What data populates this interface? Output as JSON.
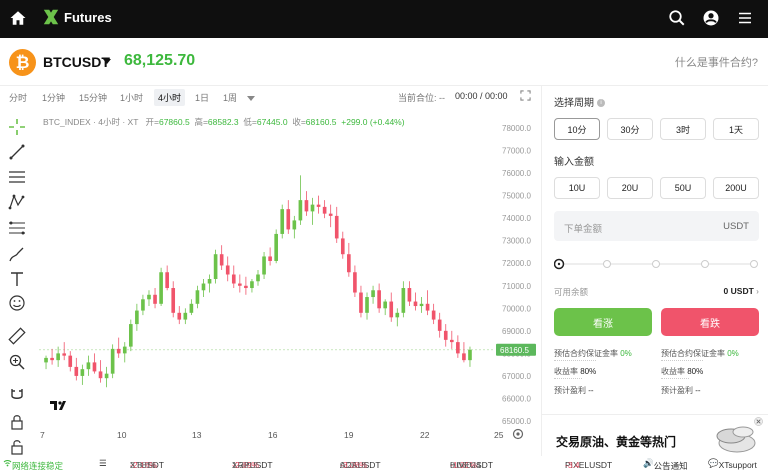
{
  "header": {
    "brand": "Futures",
    "icons": [
      "home-icon",
      "search-icon",
      "user-icon",
      "menu-icon"
    ]
  },
  "ticker": {
    "symbol": "BTCUSDT",
    "price": "68,125.70",
    "event_link": "什么是事件合约?",
    "coin_letter": "₿"
  },
  "chart_toolbar": {
    "timeframes": [
      "分时",
      "1分钟",
      "15分钟",
      "1小时",
      "4小时",
      "1日",
      "1周"
    ],
    "active_timeframe": "4小时",
    "position_info": "当前合位: --",
    "time_info": "00:00 / 00:00"
  },
  "chart_info": {
    "index_label": "BTC_INDEX · 4小时 · XT",
    "open_label": "开=",
    "open": "67860.5",
    "high_label": "高=",
    "high": "68582.3",
    "low_label": "低=",
    "low": "67445.0",
    "close_label": "收=",
    "close": "68160.5",
    "change": "+299.0 (+0.44%)"
  },
  "chart_data": {
    "type": "candlestick",
    "x_ticks": [
      "7",
      "10",
      "13",
      "16",
      "19",
      "22",
      "25"
    ],
    "y_ticks": [
      "78000.0",
      "77000.0",
      "76000.0",
      "75000.0",
      "74000.0",
      "73000.0",
      "72000.0",
      "71000.0",
      "70000.0",
      "69000.0",
      "68000.0",
      "67000.0",
      "66000.0",
      "65000.0"
    ],
    "ylim": [
      65000,
      78000
    ],
    "last_price_label": "68160.5",
    "last_price": 68160.5,
    "candles": [
      [
        67600,
        67900,
        67300,
        67800
      ],
      [
        67800,
        68200,
        67500,
        67700
      ],
      [
        67700,
        68300,
        67400,
        68000
      ],
      [
        68000,
        68500,
        67700,
        67900
      ],
      [
        67900,
        68100,
        67200,
        67400
      ],
      [
        67400,
        67800,
        66800,
        67000
      ],
      [
        67000,
        67500,
        66600,
        67300
      ],
      [
        67300,
        67900,
        67000,
        67600
      ],
      [
        67600,
        68000,
        67100,
        67200
      ],
      [
        67200,
        67700,
        66700,
        66900
      ],
      [
        66900,
        67400,
        66500,
        67100
      ],
      [
        67100,
        68400,
        66900,
        68200
      ],
      [
        68200,
        68700,
        67800,
        68000
      ],
      [
        68000,
        68500,
        67600,
        68300
      ],
      [
        68300,
        69500,
        68100,
        69300
      ],
      [
        69300,
        70200,
        69000,
        69900
      ],
      [
        69900,
        70600,
        69700,
        70400
      ],
      [
        70400,
        70800,
        70100,
        70600
      ],
      [
        70600,
        70900,
        70000,
        70200
      ],
      [
        70200,
        71800,
        70100,
        71600
      ],
      [
        71600,
        71900,
        70800,
        70900
      ],
      [
        70900,
        71200,
        69600,
        69800
      ],
      [
        69800,
        70100,
        69300,
        69500
      ],
      [
        69500,
        70000,
        69300,
        69800
      ],
      [
        69800,
        70400,
        69700,
        70200
      ],
      [
        70200,
        71000,
        70000,
        70800
      ],
      [
        70800,
        71300,
        70500,
        71100
      ],
      [
        71100,
        71500,
        70700,
        71300
      ],
      [
        71300,
        72600,
        71100,
        72400
      ],
      [
        72400,
        72800,
        71700,
        71900
      ],
      [
        71900,
        72300,
        71200,
        71500
      ],
      [
        71500,
        71900,
        70900,
        71100
      ],
      [
        71100,
        71500,
        70700,
        71000
      ],
      [
        71000,
        71400,
        70600,
        70900
      ],
      [
        70900,
        71300,
        70700,
        71200
      ],
      [
        71200,
        71700,
        71000,
        71500
      ],
      [
        71500,
        72500,
        71300,
        72300
      ],
      [
        72300,
        72700,
        71900,
        72100
      ],
      [
        72100,
        73500,
        72000,
        73300
      ],
      [
        73300,
        74600,
        73100,
        74400
      ],
      [
        74400,
        74800,
        73300,
        73500
      ],
      [
        73500,
        74100,
        73100,
        73900
      ],
      [
        73900,
        75900,
        73700,
        74800
      ],
      [
        74800,
        75200,
        74100,
        74300
      ],
      [
        74300,
        74900,
        73700,
        74600
      ],
      [
        74600,
        75000,
        74200,
        74500
      ],
      [
        74500,
        74800,
        74000,
        74200
      ],
      [
        74200,
        74600,
        73600,
        74100
      ],
      [
        74100,
        74500,
        72900,
        73100
      ],
      [
        73100,
        73400,
        72200,
        72400
      ],
      [
        72400,
        72900,
        71400,
        71600
      ],
      [
        71600,
        71900,
        70500,
        70700
      ],
      [
        70700,
        71000,
        69600,
        69800
      ],
      [
        69800,
        70700,
        69500,
        70500
      ],
      [
        70500,
        71000,
        70200,
        70800
      ],
      [
        70800,
        71100,
        69800,
        70000
      ],
      [
        70000,
        70400,
        69700,
        70300
      ],
      [
        70300,
        70700,
        69400,
        69600
      ],
      [
        69600,
        70000,
        69200,
        69800
      ],
      [
        69800,
        71200,
        69600,
        70900
      ],
      [
        70900,
        71200,
        70100,
        70300
      ],
      [
        70300,
        70700,
        69900,
        70100
      ],
      [
        70100,
        70500,
        69800,
        70200
      ],
      [
        70200,
        70800,
        69700,
        69900
      ],
      [
        69900,
        70200,
        69300,
        69500
      ],
      [
        69500,
        69800,
        68700,
        69000
      ],
      [
        69000,
        69300,
        68300,
        68600
      ],
      [
        68600,
        69000,
        68200,
        68500
      ],
      [
        68500,
        68800,
        67800,
        68000
      ],
      [
        68000,
        68500,
        67600,
        67700
      ],
      [
        67700,
        68300,
        67400,
        68160
      ]
    ]
  },
  "trade_panel": {
    "period_label": "选择周期",
    "periods": [
      "10分",
      "30分",
      "3时",
      "1天"
    ],
    "active_period": "10分",
    "amount_label": "输入金额",
    "amounts": [
      "10U",
      "20U",
      "50U",
      "200U"
    ],
    "amount_placeholder": "下单金额",
    "amount_unit": "USDT",
    "available_label": "可用余额",
    "available_value": "0 USDT",
    "up_button": "看涨",
    "down_button": "看跌",
    "up_stats": {
      "rate_label": "预估合约保证金率",
      "rate": "0%",
      "return_label": "收益率",
      "return": "80%",
      "profit_label": "预计盈利",
      "profit": "--"
    },
    "down_stats": {
      "rate_label": "预估合约保证金率",
      "rate": "0%",
      "return_label": "收益率",
      "return": "80%",
      "profit_label": "预计盈利",
      "profit": "--"
    },
    "ad_text": "交易原油、黄金等热门"
  },
  "status_bar": {
    "connection": "网络连接稳定",
    "tickers": [
      {
        "symbol": "XTUSDT",
        "change": "-2.15%",
        "price": "3.8816"
      },
      {
        "symbol": "XRPUSDT",
        "change": "-2.89%",
        "price": "1.3812"
      },
      {
        "symbol": "ADAUSDT",
        "change": "-3.08%",
        "price": "0.2513"
      },
      {
        "symbol": "HIVEUSDT",
        "change": "-1.01%",
        "price": "0.06024"
      },
      {
        "symbol": "PIXELUSDT",
        "change": "-3.4",
        "price": ""
      }
    ],
    "notice": "公告通知",
    "support": "XTsupport"
  },
  "colors": {
    "up": "#6cc24a",
    "down": "#f0546b",
    "price_green": "#3db83d",
    "header_bg": "#0f0f0f",
    "btc_orange": "#f7931a"
  }
}
